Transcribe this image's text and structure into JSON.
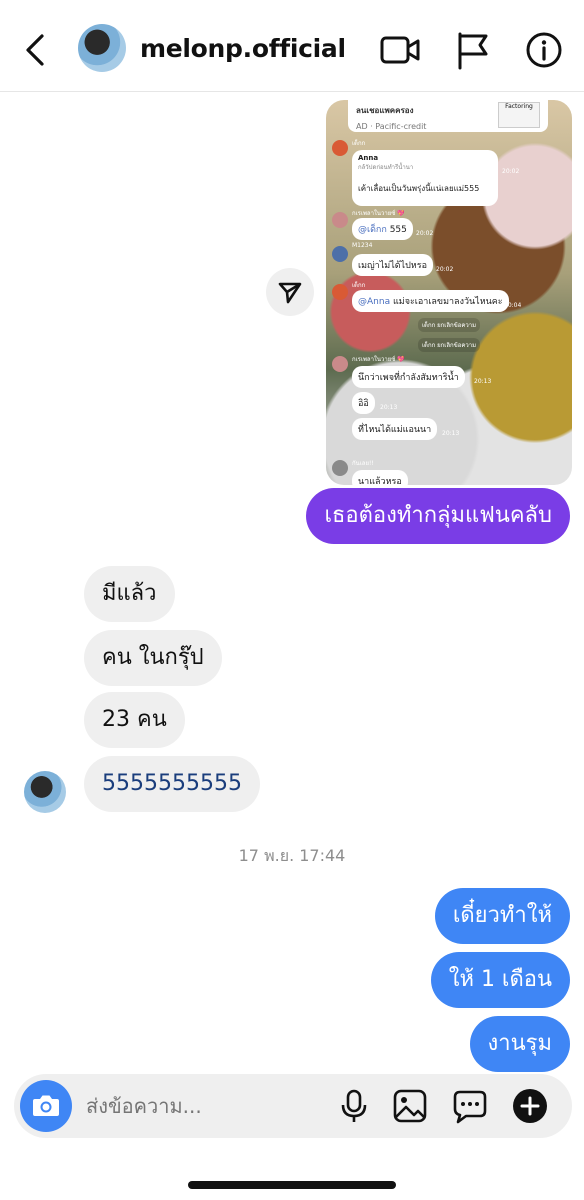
{
  "header": {
    "username": "melonp.official"
  },
  "shared_post": {
    "ad_title": "ลนเชอแพคครอง",
    "ad_sub": "AD · Pacific-credit",
    "ad_thumb": "Factoring",
    "messages": [
      {
        "sender": "เด็กก",
        "quote_name": "Anna",
        "quote_sub": "กล้วัปดก่อนทำรีน้ำนา",
        "text": "เค้าเลื่อนเป็นวันพรุ่งนี้แน่เลยแม่555",
        "time": "20:02"
      },
      {
        "sender": "กเรเพลาในวายซ์ 💖",
        "text_link": "@เด็กก",
        "text": " 555",
        "time": "20:02"
      },
      {
        "sender": "M1234",
        "text": "เมญ่าไม่ได้ไปหรอ",
        "time": "20:02"
      },
      {
        "sender": "เด็กก",
        "text_link": "@Anna",
        "text": " แม่จะเอาเลขมาลงวันไหนคะ",
        "time": "20:04"
      },
      {
        "system": "เด็กก ยกเลิกข้อความ"
      },
      {
        "system": "เด็กก ยกเลิกข้อความ"
      },
      {
        "sender": "กเรเพลาในวายซ์ 💖",
        "text": "นึกว่าเพจที่กำลังสัมทาริน้ำ",
        "time": "20:13"
      },
      {
        "text": "อิอิ",
        "time": "20:13"
      },
      {
        "text": "ที่ไหนได้แม่แอนนา",
        "time": "20:13"
      },
      {
        "sender": "กันเลย!!",
        "text": "นาแล้วหรอ"
      }
    ]
  },
  "messages": {
    "outgoing_purple": "เธอต้องทำกลุ่มแฟนคลับ",
    "incoming": [
      "มีแล้ว",
      "คน ในกรุ๊ป",
      "23 คน",
      "5555555555"
    ],
    "timestamp": "17 พ.ย. 17:44",
    "outgoing_blue": [
      "เดี๋ยวทำให้",
      "ให้ 1 เดือน",
      "งานรุม"
    ]
  },
  "composer": {
    "placeholder": "ส่งข้อความ..."
  },
  "colors": {
    "purple": "#7a3de6",
    "blue": "#3f86f5",
    "incoming_bg": "#efefef"
  },
  "icons": [
    "back-arrow-icon",
    "video-call-icon",
    "flag-icon",
    "info-icon",
    "share-icon",
    "camera-icon",
    "microphone-icon",
    "gallery-icon",
    "sticker-icon",
    "plus-icon"
  ]
}
